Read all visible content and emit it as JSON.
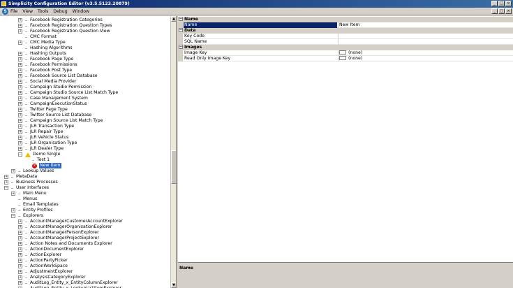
{
  "window": {
    "title": "Simplicity Configuration Editor (v3.5.5123.20879)"
  },
  "menu": {
    "items": [
      "File",
      "View",
      "Tools",
      "Debug",
      "Window"
    ]
  },
  "tree": {
    "rows": [
      {
        "label": "Facebook Registration Categories",
        "indent": 3,
        "icon": "expand"
      },
      {
        "label": "Facebook Registration Question Types",
        "indent": 3,
        "icon": "expand"
      },
      {
        "label": "Facebook Registration Question View",
        "indent": 3,
        "icon": "expand"
      },
      {
        "label": "CMC Format",
        "indent": 3,
        "icon": "leaf"
      },
      {
        "label": "CMC Media Type",
        "indent": 3,
        "icon": "expand"
      },
      {
        "label": "Hashing Algorithms",
        "indent": 3,
        "icon": "leaf"
      },
      {
        "label": "Hashing Outputs",
        "indent": 3,
        "icon": "expand"
      },
      {
        "label": "Facebook Page Type",
        "indent": 3,
        "icon": "expand"
      },
      {
        "label": "Facebook Permissions",
        "indent": 3,
        "icon": "expand"
      },
      {
        "label": "Facebook Post Type",
        "indent": 3,
        "icon": "expand"
      },
      {
        "label": "Facebook Source List Database",
        "indent": 3,
        "icon": "expand"
      },
      {
        "label": "Social Media Provider",
        "indent": 3,
        "icon": "expand"
      },
      {
        "label": "Campaign Studio Permission",
        "indent": 3,
        "icon": "expand"
      },
      {
        "label": "Campaign Studio Source List Match Type",
        "indent": 3,
        "icon": "expand"
      },
      {
        "label": "Case Management System",
        "indent": 3,
        "icon": "expand"
      },
      {
        "label": "CampaignExecutionStatus",
        "indent": 3,
        "icon": "expand"
      },
      {
        "label": "Twitter Page Type",
        "indent": 3,
        "icon": "expand"
      },
      {
        "label": "Twitter Source List Database",
        "indent": 3,
        "icon": "expand"
      },
      {
        "label": "Campaign Source List Match Type",
        "indent": 3,
        "icon": "expand"
      },
      {
        "label": "JLR Transaction Type",
        "indent": 3,
        "icon": "expand"
      },
      {
        "label": "JLR Repair Type",
        "indent": 3,
        "icon": "expand"
      },
      {
        "label": "JLR Vehicle Status",
        "indent": 3,
        "icon": "expand"
      },
      {
        "label": "JLR Organisation Type",
        "indent": 3,
        "icon": "expand"
      },
      {
        "label": "JLR Dealer Type",
        "indent": 3,
        "icon": "expand"
      },
      {
        "label": "Demo Single",
        "indent": 3,
        "icon": "collapse-warn"
      },
      {
        "label": "Test 1",
        "indent": 4,
        "icon": "leaf"
      },
      {
        "label": "New Item",
        "indent": 4,
        "icon": "error",
        "selected": true
      },
      {
        "label": "Lookup Values",
        "indent": 2,
        "icon": "expand"
      },
      {
        "label": "MetaData",
        "indent": 1,
        "icon": "expand"
      },
      {
        "label": "Business Processes",
        "indent": 1,
        "icon": "expand"
      },
      {
        "label": "User Interfaces",
        "indent": 1,
        "icon": "collapse"
      },
      {
        "label": "Main Menu",
        "indent": 2,
        "icon": "expand"
      },
      {
        "label": "Menus",
        "indent": 2,
        "icon": "leaf"
      },
      {
        "label": "Email Templates",
        "indent": 2,
        "icon": "leaf"
      },
      {
        "label": "Entity Profiles",
        "indent": 2,
        "icon": "expand"
      },
      {
        "label": "Explorers",
        "indent": 2,
        "icon": "collapse"
      },
      {
        "label": "AccountManagerCustomerAccountExplorer",
        "indent": 3,
        "icon": "expand"
      },
      {
        "label": "AccountManagerOrganisationExplorer",
        "indent": 3,
        "icon": "expand"
      },
      {
        "label": "AccountManagerPersonExplorer",
        "indent": 3,
        "icon": "expand"
      },
      {
        "label": "AccountManagerProjectExplorer",
        "indent": 3,
        "icon": "expand"
      },
      {
        "label": "Action Notes and Documents Explorer",
        "indent": 3,
        "icon": "expand"
      },
      {
        "label": "ActionDocumentExplorer",
        "indent": 3,
        "icon": "expand"
      },
      {
        "label": "ActionExplorer",
        "indent": 3,
        "icon": "expand"
      },
      {
        "label": "ActionPartyPicker",
        "indent": 3,
        "icon": "expand"
      },
      {
        "label": "ActionWorkSpace",
        "indent": 3,
        "icon": "expand"
      },
      {
        "label": "AdjustmentExplorer",
        "indent": 3,
        "icon": "expand"
      },
      {
        "label": "AnalysisCategoryExplorer",
        "indent": 3,
        "icon": "expand"
      },
      {
        "label": "AuditLog_Entity_x_EntityColumnExplorer",
        "indent": 3,
        "icon": "expand"
      },
      {
        "label": "AuditLog_Entity_x_LookupListItemExplorer",
        "indent": 3,
        "icon": "expand"
      }
    ]
  },
  "properties": {
    "sections": [
      {
        "title": "Name",
        "rows": [
          {
            "name": "Name",
            "value": "New Item",
            "selected": true
          }
        ]
      },
      {
        "title": "Data",
        "rows": [
          {
            "name": "Key Code",
            "value": ""
          },
          {
            "name": "SQL Name",
            "value": ""
          }
        ]
      },
      {
        "title": "Images",
        "rows": [
          {
            "name": "Image Key",
            "value": "(none)",
            "image": true
          },
          {
            "name": "Read Only Image Key",
            "value": "(none)",
            "image": true
          }
        ]
      }
    ],
    "description_title": "Name"
  }
}
